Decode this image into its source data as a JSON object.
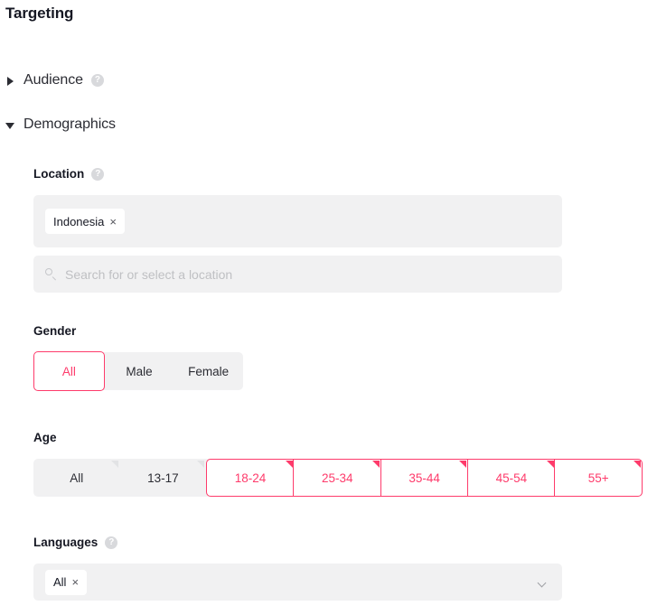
{
  "page": {
    "title": "Targeting"
  },
  "sections": [
    {
      "key": "audience",
      "label": "Audience",
      "expanded": false,
      "has_help": true,
      "help_glyph": "?"
    },
    {
      "key": "demographics",
      "label": "Demographics",
      "expanded": true,
      "has_help": false
    }
  ],
  "location": {
    "label": "Location",
    "help_glyph": "?",
    "tags": [
      {
        "label": "Indonesia",
        "remove_glyph": "×"
      }
    ],
    "search_placeholder": "Search for or select a location"
  },
  "gender": {
    "label": "Gender",
    "options": [
      {
        "label": "All",
        "selected": true
      },
      {
        "label": "Male",
        "selected": false
      },
      {
        "label": "Female",
        "selected": false
      }
    ]
  },
  "age": {
    "label": "Age",
    "options": [
      {
        "label": "All",
        "selected": false
      },
      {
        "label": "13-17",
        "selected": false
      },
      {
        "label": "18-24",
        "selected": true
      },
      {
        "label": "25-34",
        "selected": true
      },
      {
        "label": "35-44",
        "selected": true
      },
      {
        "label": "45-54",
        "selected": true
      },
      {
        "label": "55+",
        "selected": true
      }
    ]
  },
  "languages": {
    "label": "Languages",
    "help_glyph": "?",
    "tags": [
      {
        "label": "All",
        "remove_glyph": "×"
      }
    ]
  },
  "colors": {
    "accent_pink": "#fe3b6b",
    "field_gray": "#f1f1f2",
    "text_dark": "#161823",
    "placeholder_gray": "#bfc0c3"
  }
}
